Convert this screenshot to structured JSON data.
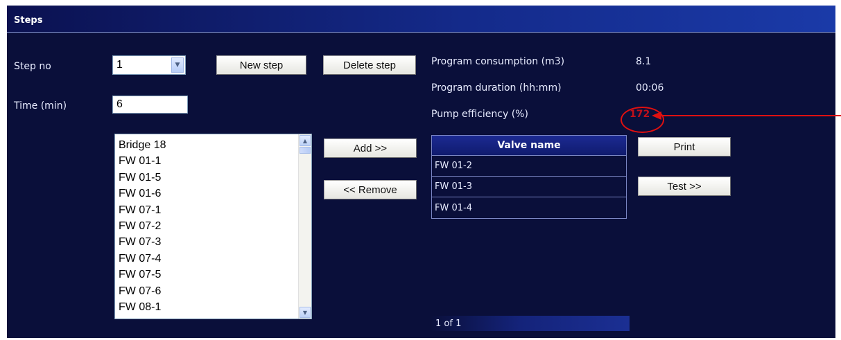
{
  "panel": {
    "title": "Steps"
  },
  "step": {
    "label": "Step no",
    "value": "1"
  },
  "time": {
    "label": "Time (min)",
    "value": "6"
  },
  "buttons": {
    "new_step": "New step",
    "delete_step": "Delete step",
    "add": "Add >>",
    "remove": "<< Remove",
    "print": "Print",
    "test": "Test >>"
  },
  "stats": {
    "consumption_label": "Program consumption (m3)",
    "consumption_value": "8.1",
    "duration_label": "Program duration (hh:mm)",
    "duration_value": "00:06",
    "efficiency_label": "Pump efficiency (%)",
    "efficiency_value": "172",
    "efficiency_color": "#c0101a"
  },
  "available_valves": [
    "Bridge 18",
    "FW 01-1",
    "FW 01-5",
    "FW 01-6",
    "FW 07-1",
    "FW 07-2",
    "FW 07-3",
    "FW 07-4",
    "FW 07-5",
    "FW 07-6",
    "FW 08-1"
  ],
  "valve_table": {
    "header": "Valve name",
    "rows": [
      "FW 01-2",
      "FW 01-3",
      "FW 01-4"
    ]
  },
  "pager": {
    "text": "1 of 1"
  },
  "annotation": {
    "color": "#e01010"
  }
}
